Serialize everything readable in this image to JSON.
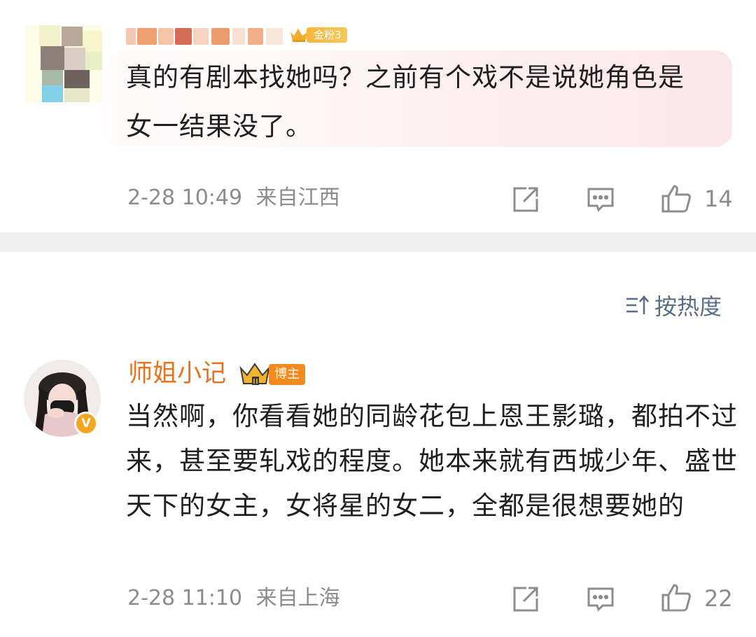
{
  "comments": [
    {
      "badge_label": "金粉3",
      "text": "真的有剧本找她吗？之前有个戏不是说她角色是女一结果没了。",
      "timestamp": "2-28 10:49",
      "location": "来自江西",
      "likes": "14",
      "icons": [
        "share-icon",
        "comment-icon",
        "like-icon"
      ]
    },
    {
      "username": "师姐小记",
      "badge_label": "博主",
      "verified_mark": "V",
      "text": "当然啊，你看看她的同龄花包上恩王影璐，都拍不过来，甚至要轧戏的程度。她本来就有西城少年、盛世天下的女主，女将星的女二，全都是很想要她的",
      "timestamp": "2-28 11:10",
      "location": "来自上海",
      "likes": "22",
      "icons": [
        "share-icon",
        "comment-icon",
        "like-icon"
      ]
    }
  ],
  "sort": {
    "icon": "sort-icon",
    "label": "按热度"
  },
  "colors": {
    "username": "#e8731e",
    "meta": "#8c8c8c",
    "sort": "#5a6f87",
    "fan_badge": "#f6b640",
    "blogger_badge": "#f38a1e",
    "divider": "#efefef"
  }
}
